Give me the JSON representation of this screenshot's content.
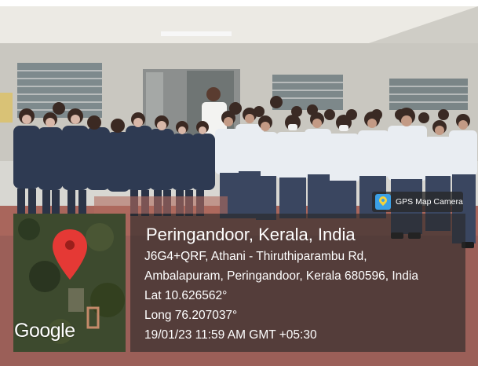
{
  "stamp": {
    "app_name": "GPS Map Camera",
    "map_attribution": "Google",
    "location_title": "Peringandoor, Kerala, India",
    "address_line1": "J6G4+QRF, Athani - Thiruthiparambu Rd,",
    "address_line2": "Ambalapuram, Peringandoor, Kerala 680596, India",
    "latitude": "Lat 10.626562°",
    "longitude": "Long 76.207037°",
    "datetime": "19/01/23 11:59 AM GMT +05:30"
  },
  "colors": {
    "map_pin": "#e53935",
    "panel_bg": "#282828",
    "uniform_shirt_boys": "#e9edf2",
    "uniform_pants": "#3a4660",
    "uniform_girls": "#2e3a52",
    "floor": "#a9665c"
  }
}
